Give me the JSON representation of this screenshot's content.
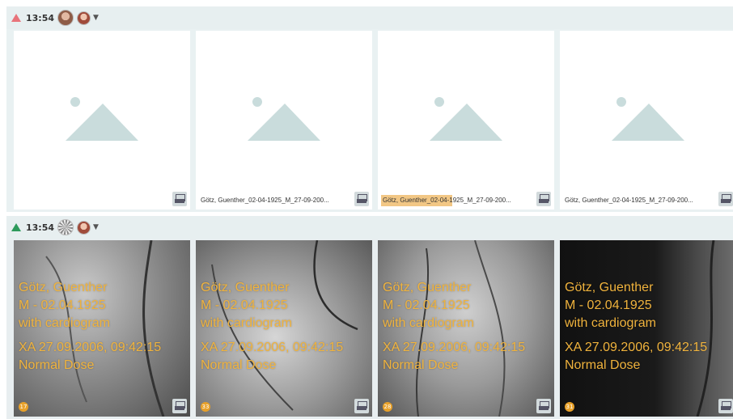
{
  "toolbar1": {
    "time": "13:54",
    "alert_color": "#e8737a"
  },
  "toolbar2": {
    "time": "13:54",
    "alert_color": "#2d9a5b"
  },
  "placeholders": [
    {
      "caption": ""
    },
    {
      "caption": "Götz, Guenther_02-04-1925_M_27-09-200..."
    },
    {
      "caption": "Götz, Guenther_02-04-1925_M_27-09-200...",
      "highlighted": true
    },
    {
      "caption": "Götz, Guenther_02-04-1925_M_27-09-200..."
    }
  ],
  "series": [
    {
      "badge": "17",
      "name": "Götz, Guenther",
      "dob": "M - 02.04.1925",
      "desc": "with cardiogram",
      "study": "XA 27.09.2006, 09:42:15",
      "dose": "Normal Dose"
    },
    {
      "badge": "33",
      "name": "Götz, Guenther",
      "dob": "M - 02.04.1925",
      "desc": "with cardiogram",
      "study": "XA 27.09.2006, 09:42:15",
      "dose": "Normal Dose"
    },
    {
      "badge": "28",
      "name": "Götz, Guenther",
      "dob": "M - 02.04.1925",
      "desc": "with cardiogram",
      "study": "XA 27.09.2006, 09:42:15",
      "dose": "Normal Dose"
    },
    {
      "badge": "31",
      "name": "Götz, Guenther",
      "dob": "M - 02.04.1925",
      "desc": "with cardiogram",
      "study": "XA 27.09.2006, 09:42:15",
      "dose": "Normal Dose"
    }
  ],
  "icons": {
    "alert": "warning-triangle-icon",
    "download": "download-archive-icon",
    "chevron": "chevron-down-icon"
  }
}
